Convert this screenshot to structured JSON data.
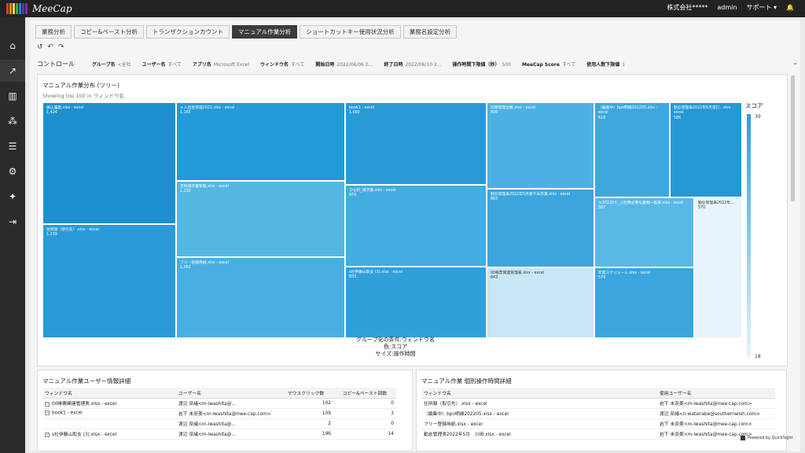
{
  "app": {
    "logo_text": "MeeCap",
    "logo_colors": [
      "#e53935",
      "#fb8c00",
      "#fdd835",
      "#43a047",
      "#1e88e5",
      "#5e35b1",
      "#8e24aa"
    ],
    "company": "株式会社*****",
    "user": "admin",
    "support": "サポート ▾",
    "bell_icon": "🔔"
  },
  "sidebar": [
    {
      "icon": "home-icon",
      "glyph": "⌂"
    },
    {
      "icon": "trend-chart-icon",
      "glyph": "↗"
    },
    {
      "icon": "bar-chart-icon",
      "glyph": "▥"
    },
    {
      "icon": "footsteps-icon",
      "glyph": "⁂"
    },
    {
      "icon": "server-icon",
      "glyph": "☰"
    },
    {
      "icon": "gear-icon",
      "glyph": "⚙"
    },
    {
      "icon": "lightbulb-icon",
      "glyph": "✦"
    },
    {
      "icon": "logout-icon",
      "glyph": "⇥"
    }
  ],
  "tabs": [
    "業務分析",
    "コピー&ペースト分析",
    "トランザクションカウント",
    "マニュアル作業分析",
    "ショートカットキー使用状況分析",
    "業務名設定分析"
  ],
  "active_tab": 3,
  "toolbar": {
    "undo": "↺",
    "redo1": "↶",
    "redo2": "↷"
  },
  "filters": {
    "title": "コントロール",
    "items": [
      {
        "label": "グループ名",
        "value": "<全社"
      },
      {
        "label": "ユーザー名",
        "value": "すべて"
      },
      {
        "label": "アプリ名",
        "value": "Microsoft Excel"
      },
      {
        "label": "ウィンドウ名",
        "value": "すべて"
      },
      {
        "label": "開始日時",
        "value": "2022/06/06 0..."
      },
      {
        "label": "終了日時",
        "value": "2022/06/10 2..."
      },
      {
        "label": "操作時間下限値（秒）",
        "value": "500"
      },
      {
        "label": "MeeCap Score",
        "value": "すべて"
      },
      {
        "label": "使用人数下限値",
        "value": "1"
      }
    ],
    "chevron": "⌄"
  },
  "treemap": {
    "title": "マニュアル作業分布 (ツリー)",
    "subtitle": "Showing top 100 in ウィンドウ名",
    "legend_title": "スコア",
    "legend_max": "39",
    "legend_min": "18",
    "caption_1": "グループ化の条件:ウィンドウ名",
    "caption_2": "色:スコア",
    "caption_3": "サイズ:操作時間"
  },
  "chart_data": {
    "type": "treemap",
    "title": "マニュアル作業分布 (ツリー)",
    "subtitle": "Showing top 100 in ウィンドウ名",
    "color_label": "スコア",
    "color_range": [
      18,
      39
    ],
    "items": [
      {
        "name": "振込履歴.xlsx - excel",
        "value": 1424
      },
      {
        "name": "住所録（取引先）.xlsx - excel",
        "value": 1239
      },
      {
        "name": "ｓ入出金管理2022.xlsx - excel",
        "value": 1165
      },
      {
        "name": "定例請求書管理.xlsx - excel",
        "value": 1130
      },
      {
        "name": "フリー登録用紙.xlsx - excel",
        "value": 1062
      },
      {
        "name": "book1 - excel",
        "value": 1000
      },
      {
        "name": "ひな形_請求書.xlsx - excel",
        "value": 970
      },
      {
        "name": "s社伊藤山取支 (3).xlsx - excel",
        "value": 833
      },
      {
        "name": "印章管理台帳.xlsx - excel",
        "value": 806
      },
      {
        "name": "勤怠管理表2022年5月岩下未奈美.xlsx - excel",
        "value": 683
      },
      {
        "name": "00帳票関連管理表.xlsx - excel",
        "value": 643
      },
      {
        "name": "（編集中）bpo明細202205.xlsx - excel",
        "value": 618
      },
      {
        "name": "勤怠管理表2022年6月度訂...xlsx - excel",
        "value": 586
      },
      {
        "name": "ｓ20220６_入社時必要な書類一覧表.xlsx - excel",
        "value": 587
      },
      {
        "name": "年間スケジュール.xlsx - excel",
        "value": 579
      },
      {
        "name": "勤怠管理表2022年...",
        "value": 570
      }
    ]
  },
  "left_table": {
    "title": "マニュアル作業ユーザー情報詳細",
    "headers": [
      "ウィンドウ名",
      "ユーザー名",
      "マウスクリック数",
      "コピー&ペースト回数"
    ],
    "rows": [
      {
        "window": "00帳票関連管理表.xlsx - excel",
        "user": "渡辺 奈緒<m-iwashita@...",
        "clicks": "102",
        "copies": "0",
        "expand": true
      },
      {
        "window": "book1 - excel",
        "user": "岩下 未奈美<m-iwashita@mee-cap.com>",
        "clicks": "109",
        "copies": "3",
        "expand": true
      },
      {
        "window": "",
        "user": "渡辺 奈緒<m-iwashita@...",
        "clicks": "2",
        "copies": "0",
        "expand": false
      },
      {
        "window": "s社伊藤山取支 (3).xlsx - excel",
        "user": "渡辺 奈緒<m-iwashita@...",
        "clicks": "196",
        "copies": "14",
        "expand": true
      }
    ]
  },
  "right_table": {
    "title": "マニュアル作業 個別操作時間詳細",
    "headers": [
      "ウィンドウ名",
      "使用ユーザー名"
    ],
    "rows": [
      {
        "window": "住所録（取引先）.xlsx - excel",
        "user": "岩下 未奈美<m-iwashita@mee-cap.com>"
      },
      {
        "window": "（編集中）bpo明細202205.xlsx - excel",
        "user": "渡辺 奈緒<n-watanabe@southernwish.com>"
      },
      {
        "window": "フリー登録用紙.xlsx - excel",
        "user": "岩下 未奈美<m-iwashita@mee-cap.com>"
      },
      {
        "window": "勤怠管理表2022年5月　川田.xlsx - excel",
        "user": "岩下 未奈美<m-iwashita@mee-cap.com>"
      }
    ]
  },
  "powered_by": "Powered by QuickSight"
}
